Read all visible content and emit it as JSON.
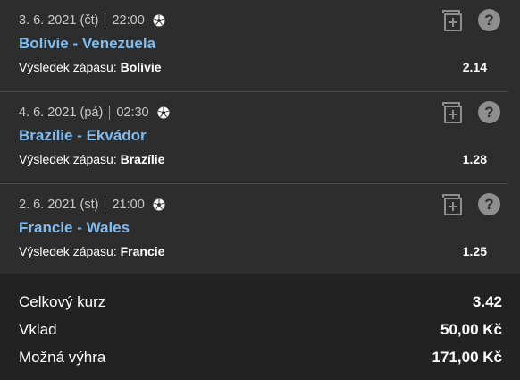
{
  "bets": [
    {
      "date": "3. 6. 2021 (čt)",
      "time": "22:00",
      "match": "Bolívie - Venezuela",
      "market_label": "Výsledek zápasu:",
      "pick": "Bolívie",
      "odds": "2.14",
      "sport_icon": "soccer-ball-icon"
    },
    {
      "date": "4. 6. 2021 (pá)",
      "time": "02:30",
      "match": "Brazílie - Ekvádor",
      "market_label": "Výsledek zápasu:",
      "pick": "Brazílie",
      "odds": "1.28",
      "sport_icon": "soccer-ball-icon"
    },
    {
      "date": "2. 6. 2021 (st)",
      "time": "21:00",
      "match": "Francie - Wales",
      "market_label": "Výsledek zápasu:",
      "pick": "Francie",
      "odds": "1.25",
      "sport_icon": "soccer-ball-icon"
    }
  ],
  "summary": {
    "total_odds_label": "Celkový kurz",
    "total_odds_value": "3.42",
    "stake_label": "Vklad",
    "stake_value": "50,00 Kč",
    "win_label": "Možná výhra",
    "win_value": "171,00 Kč"
  },
  "icons": {
    "add": "add-to-ticket-icon",
    "help": "help-icon"
  },
  "colors": {
    "background": "#2d2d2d",
    "summary_background": "#222222",
    "match_link": "#7fbcf0",
    "icon_gray": "#8e8e8e"
  }
}
